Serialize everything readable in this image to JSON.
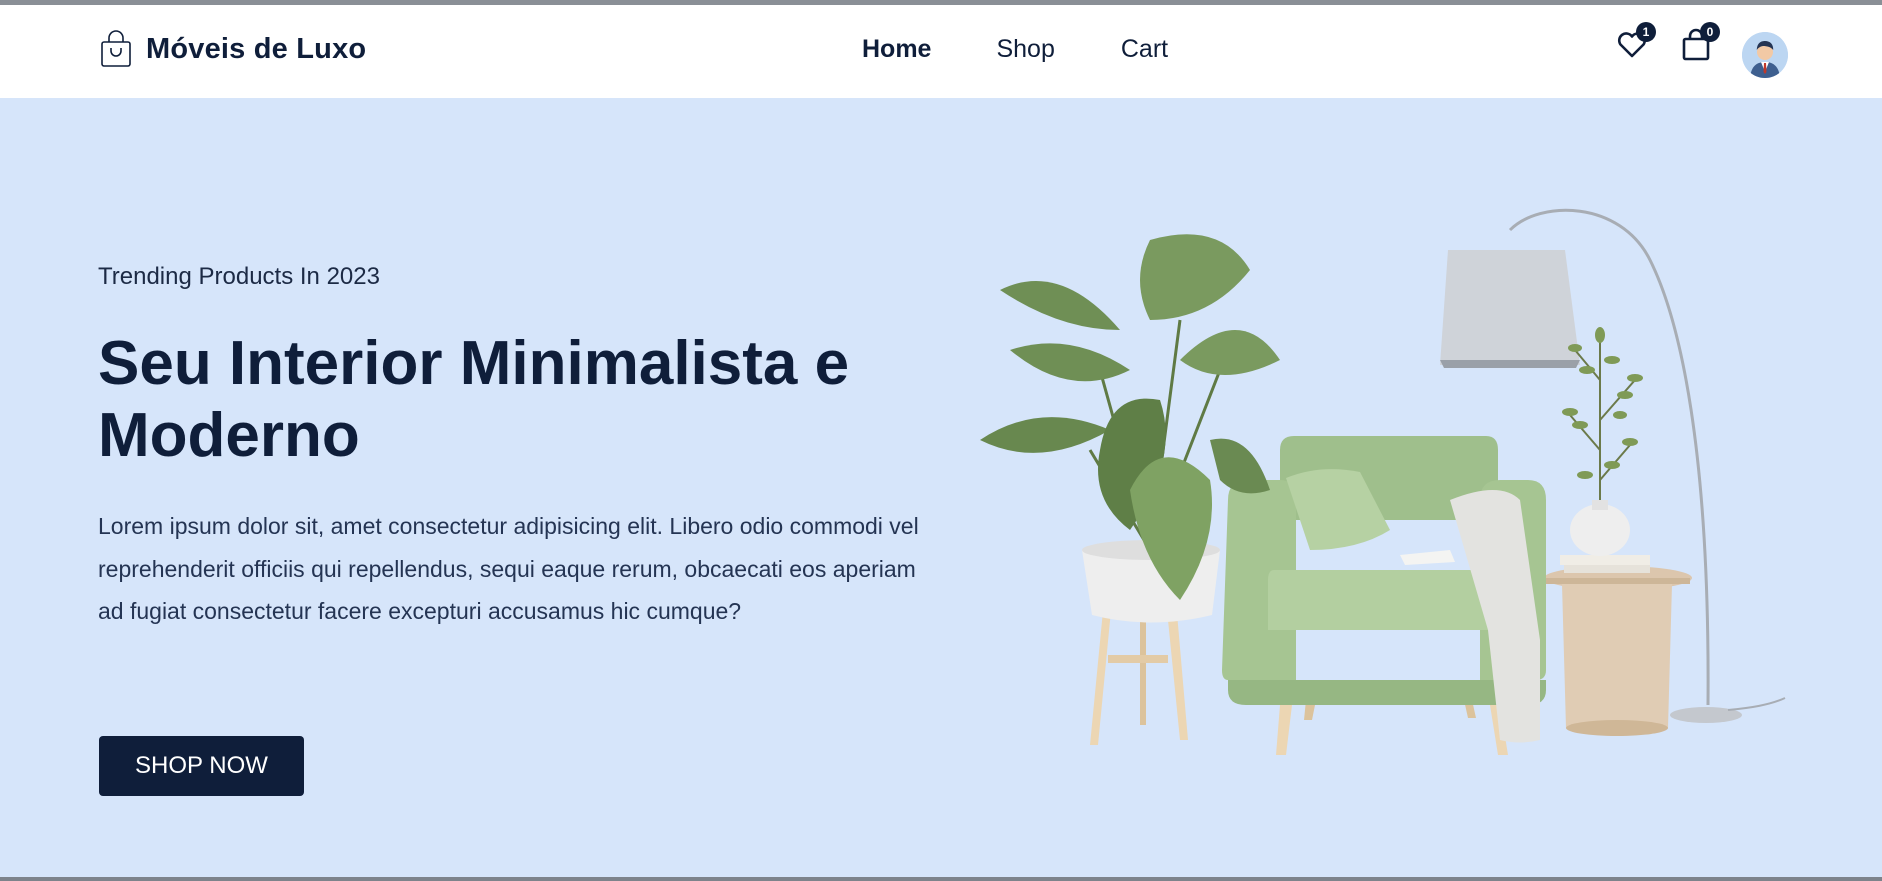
{
  "brand": {
    "name": "Móveis de Luxo",
    "icon": "shopping-bag-icon"
  },
  "nav": {
    "items": [
      {
        "label": "Home",
        "active": true
      },
      {
        "label": "Shop",
        "active": false
      },
      {
        "label": "Cart",
        "active": false
      }
    ]
  },
  "header_actions": {
    "wishlist": {
      "icon": "heart-icon",
      "count": "1"
    },
    "cart": {
      "icon": "shopping-bag-icon",
      "count": "0"
    },
    "profile": {
      "icon": "user-avatar"
    }
  },
  "hero": {
    "subtitle": "Trending Products In 2023",
    "title": "Seu Interior Minimalista e Moderno",
    "description": "Lorem ipsum dolor sit, amet consectetur adipisicing elit. Libero odio commodi vel reprehenderit officiis qui repellendus, sequi eaque rerum, obcaecati eos aperiam ad fugiat consectetur facere excepturi accusamus hic cumque?",
    "cta_label": "SHOP NOW",
    "image": "furniture-illustration"
  },
  "colors": {
    "hero_background": "#d6e5fa",
    "primary": "#0f1e3a",
    "header_background": "#ffffff",
    "armchair": "#9fc08e"
  }
}
